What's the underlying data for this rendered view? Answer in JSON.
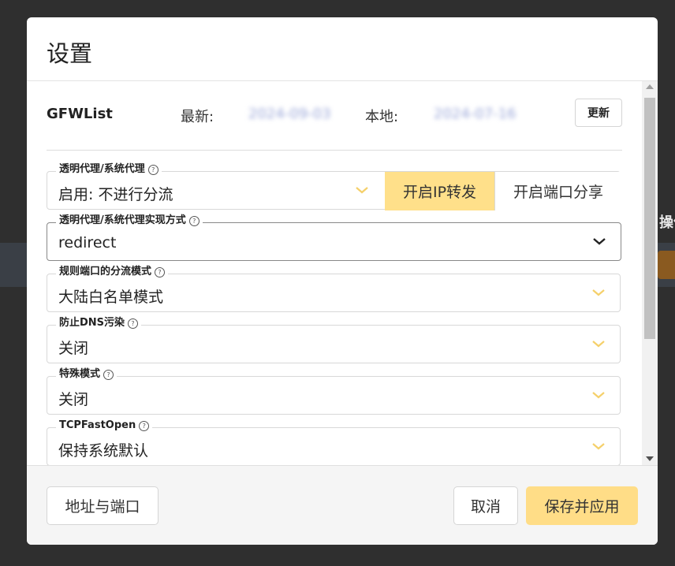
{
  "background": {
    "edge_text": "操作"
  },
  "modal": {
    "title": "设置"
  },
  "gfwlist": {
    "name": "GFWList",
    "latest_label": "最新:",
    "latest_date": "2024-09-03",
    "local_label": "本地:",
    "local_date": "2024-07-16",
    "update_label": "更新"
  },
  "fields": {
    "proxy": {
      "legend": "透明代理/系统代理",
      "value": "启用: 不进行分流",
      "ip_forward_label": "开启IP转发",
      "port_share_label": "开启端口分享"
    },
    "proxy_method": {
      "legend": "透明代理/系统代理实现方式",
      "value": "redirect"
    },
    "rule_port_mode": {
      "legend": "规则端口的分流模式",
      "value": "大陆白名单模式"
    },
    "anti_dns": {
      "legend": "防止DNS污染",
      "value": "关闭"
    },
    "special_mode": {
      "legend": "特殊模式",
      "value": "关闭"
    },
    "tcp_fast_open": {
      "legend": "TCPFastOpen",
      "value": "保持系统默认"
    }
  },
  "footer": {
    "address_port_label": "地址与端口",
    "cancel_label": "取消",
    "save_apply_label": "保存并应用"
  },
  "colors": {
    "accent": "#ffe08a",
    "chevron_light": "#f5d06a",
    "chevron_dark": "#222222"
  }
}
